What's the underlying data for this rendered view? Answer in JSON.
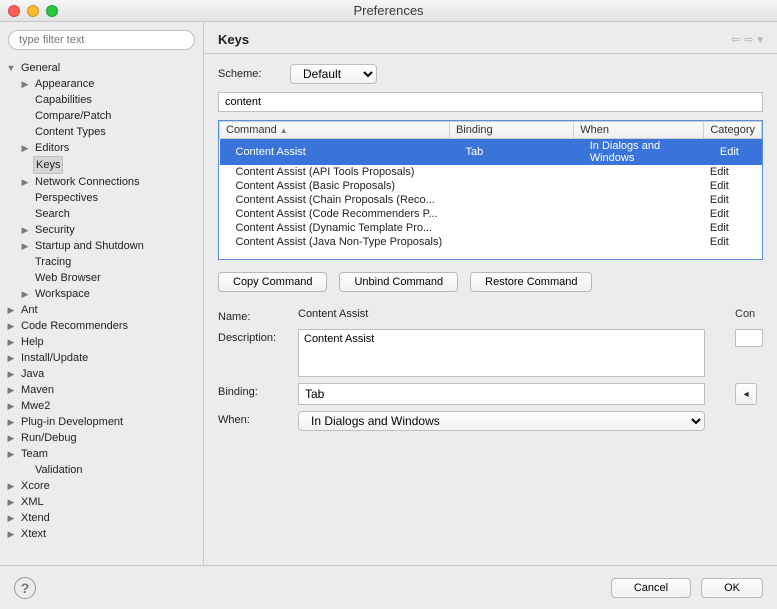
{
  "window": {
    "title": "Preferences"
  },
  "sidebar": {
    "filter_placeholder": "type filter text",
    "items": [
      {
        "label": "General",
        "indent": 0,
        "arrow": "open"
      },
      {
        "label": "Appearance",
        "indent": 1,
        "arrow": "closed"
      },
      {
        "label": "Capabilities",
        "indent": 1,
        "arrow": "none"
      },
      {
        "label": "Compare/Patch",
        "indent": 1,
        "arrow": "none"
      },
      {
        "label": "Content Types",
        "indent": 1,
        "arrow": "none"
      },
      {
        "label": "Editors",
        "indent": 1,
        "arrow": "closed"
      },
      {
        "label": "Keys",
        "indent": 1,
        "arrow": "none",
        "selected": true
      },
      {
        "label": "Network Connections",
        "indent": 1,
        "arrow": "closed"
      },
      {
        "label": "Perspectives",
        "indent": 1,
        "arrow": "none"
      },
      {
        "label": "Search",
        "indent": 1,
        "arrow": "none"
      },
      {
        "label": "Security",
        "indent": 1,
        "arrow": "closed"
      },
      {
        "label": "Startup and Shutdown",
        "indent": 1,
        "arrow": "closed"
      },
      {
        "label": "Tracing",
        "indent": 1,
        "arrow": "none"
      },
      {
        "label": "Web Browser",
        "indent": 1,
        "arrow": "none"
      },
      {
        "label": "Workspace",
        "indent": 1,
        "arrow": "closed"
      },
      {
        "label": "Ant",
        "indent": 0,
        "arrow": "closed"
      },
      {
        "label": "Code Recommenders",
        "indent": 0,
        "arrow": "closed"
      },
      {
        "label": "Help",
        "indent": 0,
        "arrow": "closed"
      },
      {
        "label": "Install/Update",
        "indent": 0,
        "arrow": "closed"
      },
      {
        "label": "Java",
        "indent": 0,
        "arrow": "closed"
      },
      {
        "label": "Maven",
        "indent": 0,
        "arrow": "closed"
      },
      {
        "label": "Mwe2",
        "indent": 0,
        "arrow": "closed"
      },
      {
        "label": "Plug-in Development",
        "indent": 0,
        "arrow": "closed"
      },
      {
        "label": "Run/Debug",
        "indent": 0,
        "arrow": "closed"
      },
      {
        "label": "Team",
        "indent": 0,
        "arrow": "closed"
      },
      {
        "label": "Validation",
        "indent": 1,
        "arrow": "none"
      },
      {
        "label": "Xcore",
        "indent": 0,
        "arrow": "closed"
      },
      {
        "label": "XML",
        "indent": 0,
        "arrow": "closed"
      },
      {
        "label": "Xtend",
        "indent": 0,
        "arrow": "closed"
      },
      {
        "label": "Xtext",
        "indent": 0,
        "arrow": "closed"
      }
    ]
  },
  "page": {
    "title": "Keys",
    "scheme_label": "Scheme:",
    "scheme_value": "Default",
    "filter_value": "content",
    "columns": {
      "command": "Command",
      "binding": "Binding",
      "when": "When",
      "category": "Category"
    },
    "rows": [
      {
        "command": "Content Assist",
        "binding": "Tab",
        "when": "In Dialogs and Windows",
        "category": "Edit",
        "selected": true
      },
      {
        "command": "Content Assist (API Tools Proposals)",
        "binding": "",
        "when": "",
        "category": "Edit"
      },
      {
        "command": "Content Assist (Basic Proposals)",
        "binding": "",
        "when": "",
        "category": "Edit"
      },
      {
        "command": "Content Assist (Chain Proposals (Reco...",
        "binding": "",
        "when": "",
        "category": "Edit"
      },
      {
        "command": "Content Assist (Code Recommenders P...",
        "binding": "",
        "when": "",
        "category": "Edit"
      },
      {
        "command": "Content Assist (Dynamic Template Pro...",
        "binding": "",
        "when": "",
        "category": "Edit"
      },
      {
        "command": "Content Assist (Java Non-Type Proposals)",
        "binding": "",
        "when": "",
        "category": "Edit"
      }
    ],
    "buttons": {
      "copy": "Copy Command",
      "unbind": "Unbind Command",
      "restore": "Restore Command"
    },
    "form": {
      "name_label": "Name:",
      "name_value": "Content Assist",
      "desc_label": "Description:",
      "desc_value": "Content Assist",
      "conflicts_label": "Con",
      "conflicts_col": "Con",
      "binding_label": "Binding:",
      "binding_value": "Tab",
      "when_label": "When:",
      "when_value": "In Dialogs and Windows"
    }
  },
  "footer": {
    "cancel": "Cancel",
    "ok": "OK"
  }
}
